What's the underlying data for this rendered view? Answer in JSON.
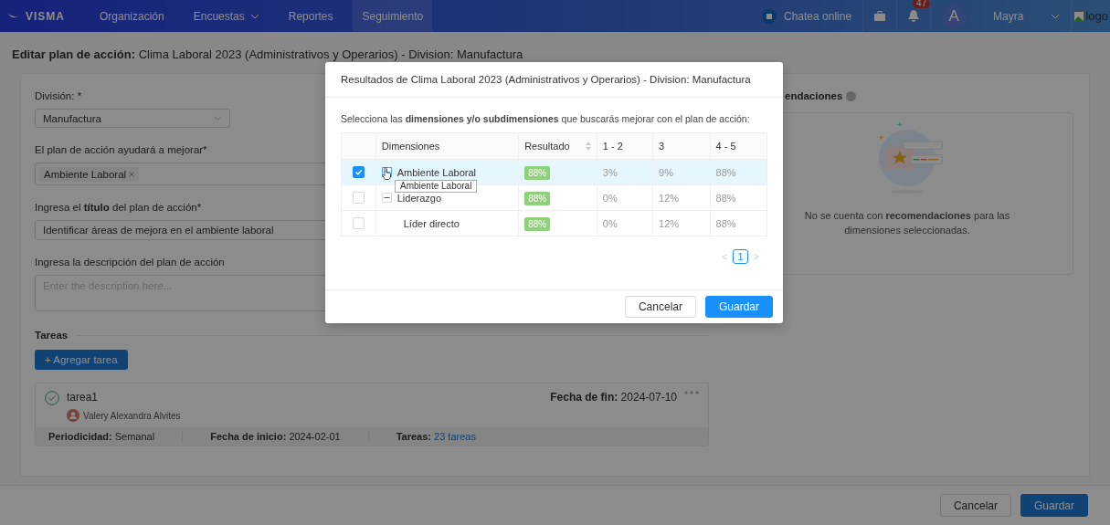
{
  "navbar": {
    "brand": "VISMA",
    "items": [
      {
        "label": "Organización",
        "dropdown": false,
        "selected": false
      },
      {
        "label": "Encuestas",
        "dropdown": true,
        "selected": false
      },
      {
        "label": "Reportes",
        "dropdown": false,
        "selected": false
      },
      {
        "label": "Seguimiento",
        "dropdown": false,
        "selected": true
      }
    ],
    "chat": "Chatea online",
    "notifications": "47",
    "avatar": "A",
    "user": "Mayra",
    "logo_alt": "logo"
  },
  "page_title": "**Editar plan de acción:** Clima Laboral 2023 (Administrativos y Operarios) - Division: Manufactura",
  "form": {
    "division_label": "División: *",
    "division_value": "Manufactura",
    "improve_label": "El plan de acción ayudará a mejorar*",
    "improve_tags": [
      "Ambiente Laboral"
    ],
    "title_label": "Ingresa el **título** del plan de acción*",
    "title_value": "Identificar áreas de mejora en el ambiente laboral",
    "description_label": "Ingresa la descripción del plan de acción",
    "description_placeholder": "Enter the description here...",
    "tasks_heading": "Tareas",
    "add_task": "+ Agregar tarea",
    "task": {
      "name": "tarea1",
      "assignee": "Valery Alexandra Alvites",
      "end_label": "Fecha de fin:",
      "end_value": "2024-07-10",
      "details": [
        {
          "label": "Periodicidad:",
          "value": "Semanal"
        },
        {
          "label": "Fecha de inicio:",
          "value": "2024-02-01"
        },
        {
          "label": "Tareas:",
          "link": "23 tareas"
        }
      ]
    }
  },
  "recommendations": {
    "title": "endaciones",
    "empty": "No se cuenta con **recomendaciones** para las dimensiones seleccionadas."
  },
  "footer": {
    "buttons": [
      {
        "label": "Cancelar",
        "primary": false
      },
      {
        "label": "Guardar",
        "primary": true
      }
    ]
  },
  "modal": {
    "title": "Resultados de Clima Laboral 2023 (Administrativos y Operarios) - Division: Manufactura",
    "instruction": "Selecciona las **dimensiones y/o subdimensiones** que buscarás mejorar con el plan de acción:",
    "table": {
      "columns": [
        "Dimensiones",
        "Resultado",
        "1 - 2",
        "3",
        "4 - 5"
      ],
      "rows": [
        {
          "name": "Ambiente Laboral",
          "checked": true,
          "expanded": false,
          "result": "88%",
          "c12": "3%",
          "c3": "9%",
          "c45": "88%"
        },
        {
          "name": "Liderazgo",
          "checked": false,
          "expanded": true,
          "result": "88%",
          "c12": "0%",
          "c3": "12%",
          "c45": "88%",
          "children": [
            {
              "name": "Líder directo",
              "checked": false,
              "result": "88%",
              "c12": "0%",
              "c3": "12%",
              "c45": "88%"
            }
          ]
        }
      ]
    },
    "tooltip": "Ambiente Laboral",
    "pagination": {
      "prev": "<",
      "pages": [
        {
          "label": "1",
          "selected": true
        }
      ],
      "next": ">"
    },
    "buttons": [
      {
        "label": "Cancelar",
        "primary": false
      },
      {
        "label": "Guardar",
        "primary": true
      }
    ]
  }
}
